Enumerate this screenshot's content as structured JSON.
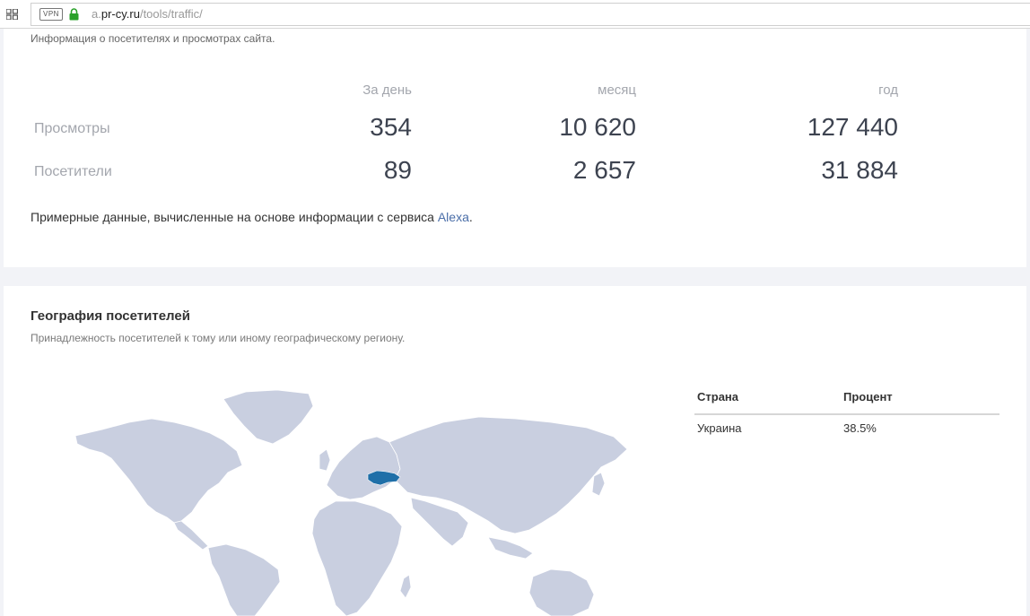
{
  "browser": {
    "vpn_label": "VPN",
    "url_sub": "a.",
    "url_domain": "pr-cy.ru",
    "url_path": "/tools/traffic/"
  },
  "traffic": {
    "description": "Информация о посетителях и просмотрах сайта.",
    "columns": [
      "За день",
      "месяц",
      "год"
    ],
    "rows": [
      {
        "label": "Просмотры",
        "values": [
          "354",
          "10 620",
          "127 440"
        ]
      },
      {
        "label": "Посетители",
        "values": [
          "89",
          "2 657",
          "31 884"
        ]
      }
    ],
    "note_text": "Примерные данные, вычисленные на основе информации с сервиса ",
    "note_link": "Alexa",
    "note_end": "."
  },
  "geo": {
    "title": "География посетителей",
    "description": "Принадлежность посетителей к тому или иному географическому региону.",
    "table_headers": [
      "Страна",
      "Процент"
    ],
    "rows": [
      {
        "country": "Украина",
        "percent": "38.5%"
      }
    ],
    "map_land_color": "#c9cfe0",
    "map_highlight_color": "#1f6fa8"
  }
}
